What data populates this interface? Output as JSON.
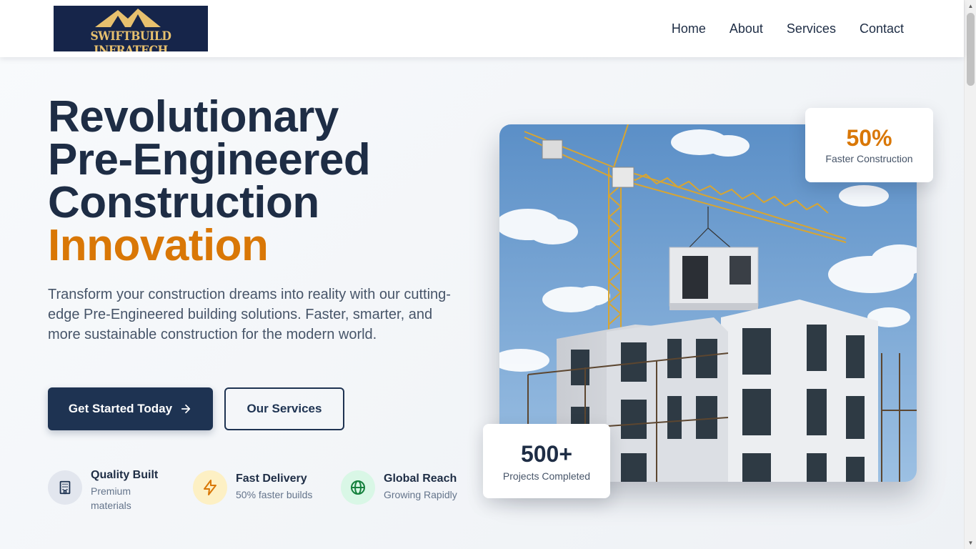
{
  "brand": {
    "logo_text": "SWIFTBUILD INFRATECH"
  },
  "nav": {
    "items": [
      "Home",
      "About",
      "Services",
      "Contact"
    ]
  },
  "hero": {
    "title_lines": [
      "Revolutionary",
      "Pre-Engineered",
      "Construction"
    ],
    "title_accent": "Innovation",
    "description": "Transform your construction dreams into reality with our cutting-edge Pre-Engineered building solutions. Faster, smarter, and more sustainable construction for the modern world.",
    "primary_button": "Get Started Today",
    "secondary_button": "Our Services"
  },
  "features": [
    {
      "icon": "building-icon",
      "title": "Quality Built",
      "subtitle": "Premium materials"
    },
    {
      "icon": "lightning-icon",
      "title": "Fast Delivery",
      "subtitle": "50% faster builds"
    },
    {
      "icon": "globe-icon",
      "title": "Global Reach",
      "subtitle": "Growing Rapidly"
    }
  ],
  "stats": {
    "top": {
      "value": "50%",
      "label": "Faster Construction"
    },
    "bottom": {
      "value": "500+",
      "label": "Projects Completed"
    }
  },
  "colors": {
    "navy": "#1e3352",
    "accent": "#d97706",
    "text_muted": "#475569"
  }
}
